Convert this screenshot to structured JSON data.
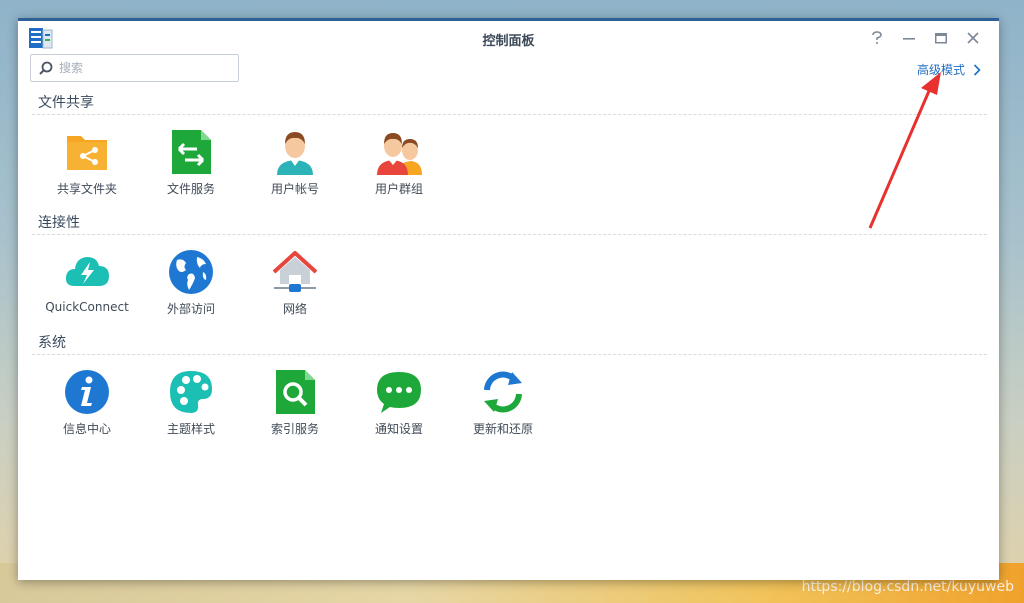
{
  "window": {
    "title": "控制面板"
  },
  "search": {
    "placeholder": "搜索",
    "value": ""
  },
  "advanced": {
    "label": "高级模式"
  },
  "sections": [
    {
      "title": "文件共享",
      "items": [
        {
          "label": "共享文件夹",
          "icon": "shared-folder-icon"
        },
        {
          "label": "文件服务",
          "icon": "file-services-icon"
        },
        {
          "label": "用户帐号",
          "icon": "user-icon"
        },
        {
          "label": "用户群组",
          "icon": "group-icon"
        }
      ]
    },
    {
      "title": "连接性",
      "items": [
        {
          "label": "QuickConnect",
          "icon": "quickconnect-icon"
        },
        {
          "label": "外部访问",
          "icon": "globe-icon"
        },
        {
          "label": "网络",
          "icon": "network-house-icon"
        }
      ]
    },
    {
      "title": "系统",
      "items": [
        {
          "label": "信息中心",
          "icon": "info-icon"
        },
        {
          "label": "主题样式",
          "icon": "palette-icon"
        },
        {
          "label": "索引服务",
          "icon": "index-search-icon"
        },
        {
          "label": "通知设置",
          "icon": "chat-bubble-icon"
        },
        {
          "label": "更新和还原",
          "icon": "refresh-icon"
        }
      ]
    }
  ],
  "watermark": "https://blog.csdn.net/kuyuweb",
  "colors": {
    "accent": "#1f6fc5",
    "annotation": "#e8312f"
  }
}
